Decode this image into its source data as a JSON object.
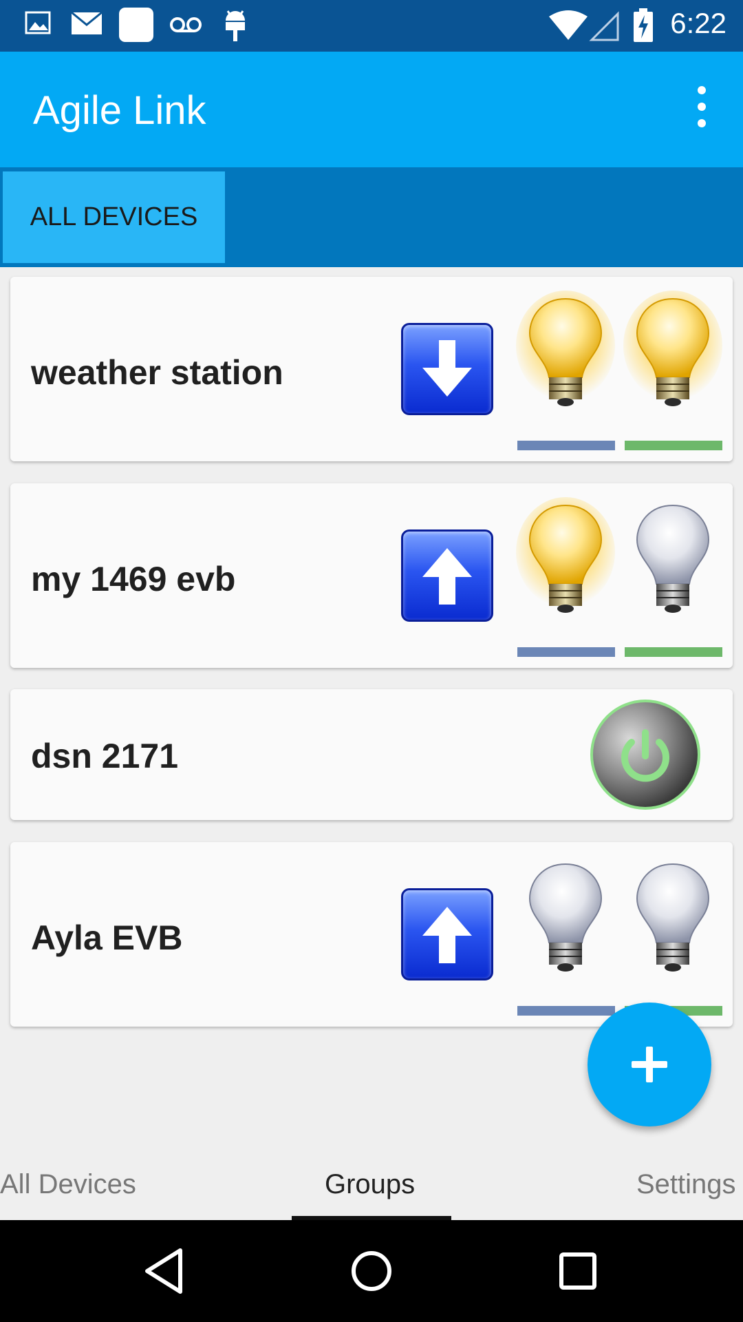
{
  "status_bar": {
    "time": "6:22",
    "icons": [
      "image-icon",
      "mail-icon",
      "app-square-icon",
      "voicemail-icon",
      "android-icon",
      "wifi-icon",
      "signal-icon",
      "battery-charging-icon"
    ]
  },
  "app_bar": {
    "title": "Agile Link",
    "menu_icon": "overflow-menu-icon"
  },
  "tabs": {
    "active_label": "ALL DEVICES"
  },
  "devices": [
    {
      "name": "weather station",
      "arrow": "down",
      "bulbs": [
        {
          "on": true,
          "bar": "blue"
        },
        {
          "on": true,
          "bar": "green"
        }
      ]
    },
    {
      "name": "my 1469 evb",
      "arrow": "up",
      "bulbs": [
        {
          "on": true,
          "bar": "blue"
        },
        {
          "on": false,
          "bar": "green"
        }
      ]
    },
    {
      "name": "dsn 2171",
      "control": "power-button"
    },
    {
      "name": "Ayla EVB",
      "arrow": "up",
      "bulbs": [
        {
          "on": false,
          "bar": "blue"
        },
        {
          "on": false,
          "bar": "green"
        }
      ]
    }
  ],
  "fab": {
    "icon": "plus-icon"
  },
  "bottom_tabs": {
    "items": [
      "All Devices",
      "Groups",
      "Settings"
    ],
    "active": "Groups"
  },
  "nav_bar": {
    "icons": [
      "back-icon",
      "home-icon",
      "recents-icon"
    ]
  },
  "colors": {
    "status_bar": "#0a5494",
    "app_bar": "#03a9f4",
    "tab_strip": "#0277bd",
    "active_tab": "#29b6f6",
    "fab": "#03a9f4",
    "bar_blue": "#6b86b6",
    "bar_green": "#6db86a"
  }
}
